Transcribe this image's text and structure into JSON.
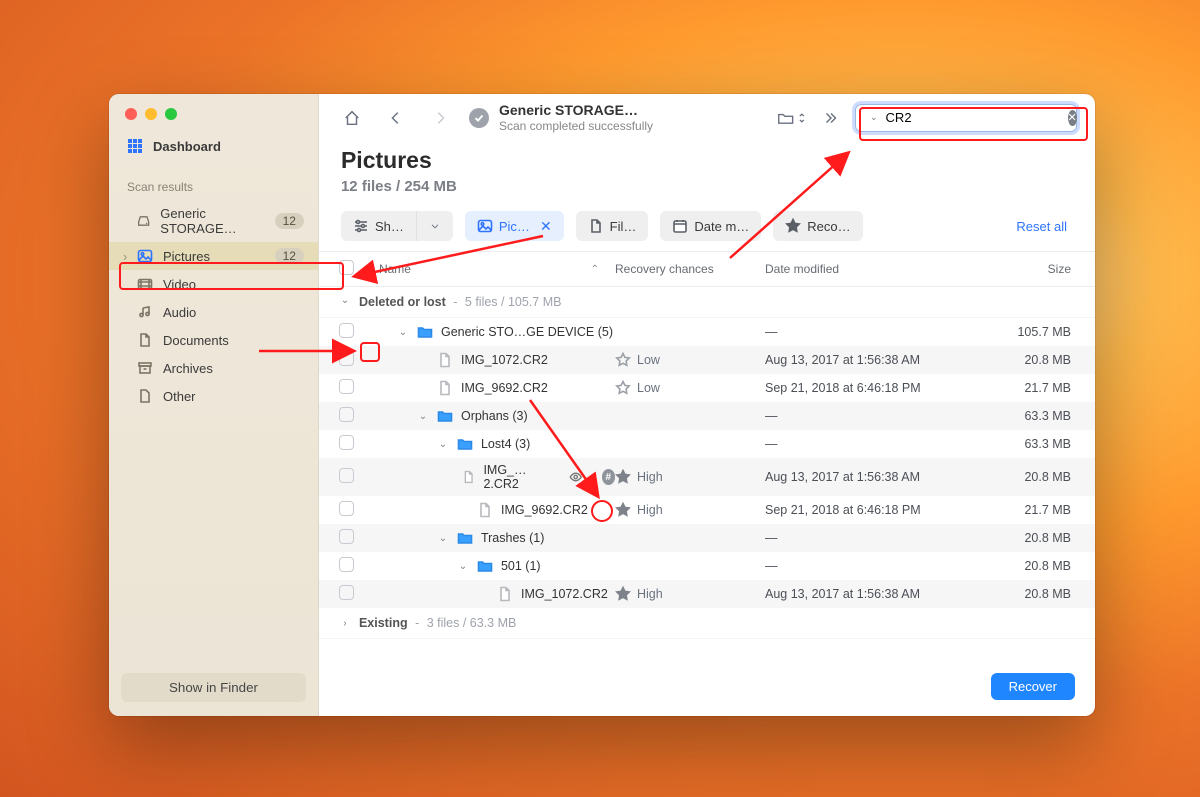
{
  "sidebar": {
    "dashboard": "Dashboard",
    "scan_results_title": "Scan results",
    "items": [
      {
        "label": "Generic STORAGE…",
        "count": "12"
      },
      {
        "label": "Pictures",
        "count": "12"
      },
      {
        "label": "Video"
      },
      {
        "label": "Audio"
      },
      {
        "label": "Documents"
      },
      {
        "label": "Archives"
      },
      {
        "label": "Other"
      }
    ],
    "show_in_finder": "Show in Finder"
  },
  "topbar": {
    "title": "Generic STORAGE…",
    "subtitle": "Scan completed successfully",
    "search_value": "CR2"
  },
  "page": {
    "title": "Pictures",
    "subtitle": "12 files / 254 MB"
  },
  "filters": {
    "show": "Sh…",
    "type": "Pic…",
    "filesize": "Fil…",
    "datemod": "Date m…",
    "recovery": "Reco…",
    "reset": "Reset all"
  },
  "columns": {
    "name": "Name",
    "rec": "Recovery chances",
    "date": "Date modified",
    "size": "Size"
  },
  "groups": {
    "deleted": {
      "label": "Deleted or lost",
      "meta": "5 files / 105.7 MB"
    },
    "existing": {
      "label": "Existing",
      "meta": "3 files / 63.3 MB"
    }
  },
  "rows": [
    {
      "indent": 1,
      "alt": false,
      "folder": true,
      "expand": "down",
      "name": "Generic STO…GE DEVICE (5)",
      "rec": "",
      "date": "—",
      "size": "105.7 MB"
    },
    {
      "indent": 2,
      "alt": true,
      "folder": false,
      "name": "IMG_1072.CR2",
      "rec": "Low",
      "star": "outline",
      "date": "Aug 13, 2017 at 1:56:38 AM",
      "size": "20.8 MB"
    },
    {
      "indent": 2,
      "alt": false,
      "folder": false,
      "name": "IMG_9692.CR2",
      "rec": "Low",
      "star": "outline",
      "date": "Sep 21, 2018 at 6:46:18 PM",
      "size": "21.7 MB"
    },
    {
      "indent": 2,
      "alt": true,
      "folder": true,
      "expand": "down",
      "name": "Orphans (3)",
      "rec": "",
      "date": "—",
      "size": "63.3 MB"
    },
    {
      "indent": 3,
      "alt": false,
      "folder": true,
      "expand": "down",
      "name": "Lost4 (3)",
      "rec": "",
      "date": "—",
      "size": "63.3 MB"
    },
    {
      "indent": 4,
      "alt": true,
      "folder": false,
      "name": "IMG_…2.CR2",
      "rec": "High",
      "star": "fill",
      "eye": true,
      "date": "Aug 13, 2017 at 1:56:38 AM",
      "size": "20.8 MB"
    },
    {
      "indent": 4,
      "alt": false,
      "folder": false,
      "name": "IMG_9692.CR2",
      "rec": "High",
      "star": "fill",
      "date": "Sep 21, 2018 at 6:46:18 PM",
      "size": "21.7 MB"
    },
    {
      "indent": 3,
      "alt": true,
      "folder": true,
      "expand": "down",
      "name": "Trashes (1)",
      "rec": "",
      "date": "—",
      "size": "20.8 MB"
    },
    {
      "indent": 4,
      "alt": false,
      "folder": true,
      "expand": "down",
      "name": "501 (1)",
      "rec": "",
      "date": "—",
      "size": "20.8 MB"
    },
    {
      "indent": 5,
      "alt": true,
      "folder": false,
      "name": "IMG_1072.CR2",
      "rec": "High",
      "star": "fill",
      "date": "Aug 13, 2017 at 1:56:38 AM",
      "size": "20.8 MB"
    }
  ],
  "footer": {
    "recover": "Recover"
  }
}
